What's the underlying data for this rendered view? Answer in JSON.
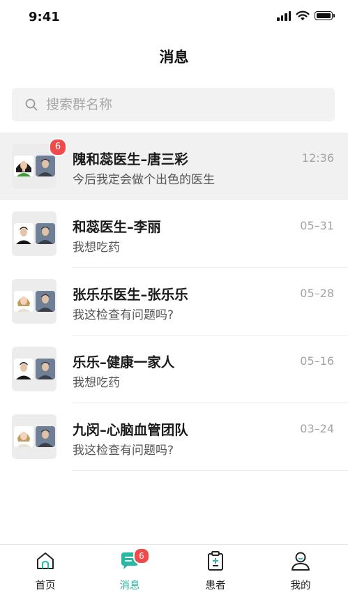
{
  "status_bar": {
    "time": "9:41"
  },
  "nav": {
    "title": "消息"
  },
  "search": {
    "placeholder": "搜索群名称",
    "value": ""
  },
  "chats": [
    {
      "name": "隗和蕊医生–唐三彩",
      "preview": "今后我定会做个出色的医生",
      "time": "12:36",
      "unread": "6",
      "active": true,
      "left_avatar": "female-doctor"
    },
    {
      "name": "和蕊医生–李丽",
      "preview": "我想吃药",
      "time": "05–31",
      "unread": "",
      "active": false,
      "left_avatar": "male-dark"
    },
    {
      "name": "张乐乐医生–张乐乐",
      "preview": "我这检查有问题吗?",
      "time": "05–28",
      "unread": "",
      "active": false,
      "left_avatar": "female-light"
    },
    {
      "name": "乐乐–健康一家人",
      "preview": "我想吃药",
      "time": "05–16",
      "unread": "",
      "active": false,
      "left_avatar": "male-dark"
    },
    {
      "name": "九闵–心脑血管团队",
      "preview": "我这检查有问题吗?",
      "time": "03–24",
      "unread": "",
      "active": false,
      "left_avatar": "female-light"
    }
  ],
  "tabbar": {
    "items": [
      {
        "label": "首页",
        "icon": "home-icon"
      },
      {
        "label": "消息",
        "icon": "message-icon",
        "badge": "6"
      },
      {
        "label": "患者",
        "icon": "clipboard-icon"
      },
      {
        "label": "我的",
        "icon": "user-icon"
      }
    ]
  },
  "colors": {
    "accent": "#27b9a6",
    "badge": "#f04b4b",
    "active_row": "#f1f1f1"
  }
}
